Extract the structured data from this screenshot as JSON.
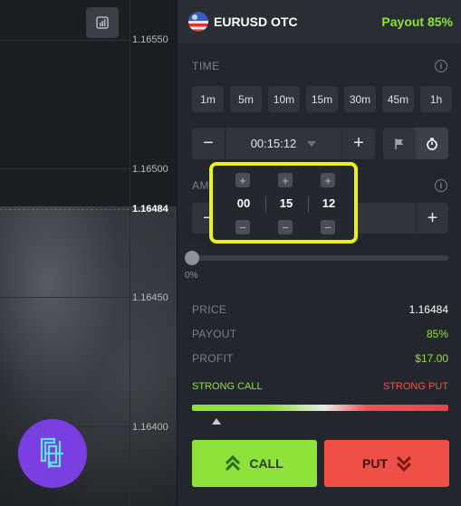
{
  "chart": {
    "axis": [
      "1.16550",
      "1.16500",
      "1.16484",
      "1.16450",
      "1.16400"
    ],
    "current_price": "1.16484"
  },
  "header": {
    "pair": "EURUSD OTC",
    "payout": "Payout 85%"
  },
  "time": {
    "label": "TIME",
    "presets": [
      "1m",
      "5m",
      "10m",
      "15m",
      "30m",
      "45m",
      "1h"
    ],
    "value": "00:15:12",
    "minus": "−",
    "plus": "+"
  },
  "amount": {
    "label": "AMO",
    "minus": "−",
    "plus": "+",
    "percent": "0%"
  },
  "picker": {
    "hours": "00",
    "minutes": "15",
    "seconds": "12",
    "plus": "+",
    "minus": "−"
  },
  "stats": {
    "price_label": "PRICE",
    "price_value": "1.16484",
    "payout_label": "PAYOUT",
    "payout_value": "85%",
    "profit_label": "PROFIT",
    "profit_value": "$17.00"
  },
  "strength": {
    "call_label": "STRONG CALL",
    "put_label": "STRONG PUT"
  },
  "actions": {
    "call": "CALL",
    "put": "PUT"
  },
  "colors": {
    "green": "#8ee33a",
    "red": "#ee5048",
    "highlight": "#eef01b",
    "logo": "#7a3fe0"
  }
}
